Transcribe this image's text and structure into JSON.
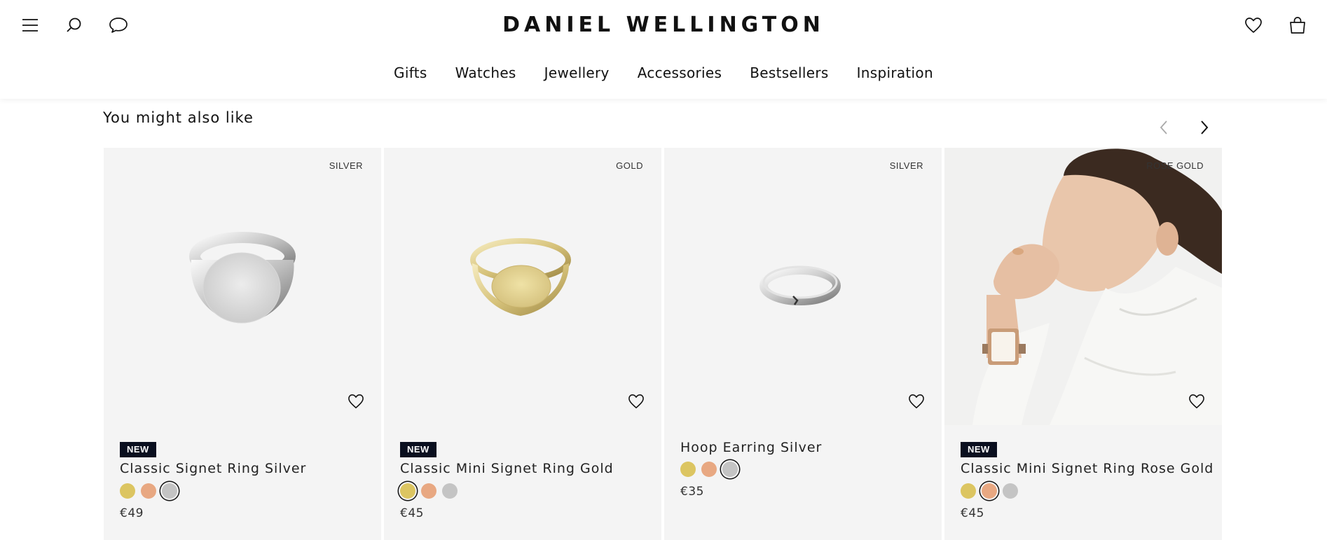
{
  "header": {
    "brand": "DANIEL WELLINGTON",
    "nav": [
      "Gifts",
      "Watches",
      "Jewellery",
      "Accessories",
      "Bestsellers",
      "Inspiration"
    ],
    "icons": [
      "menu-icon",
      "search-icon",
      "chat-icon",
      "heart-icon",
      "bag-icon"
    ]
  },
  "section": {
    "title": "You might also like"
  },
  "colors": {
    "gold": "#dcc561",
    "rose": "#e8a882",
    "silver": "#c4c4c4",
    "badge": "#0a0f1f",
    "card_bg": "#f4f4f4"
  },
  "products": [
    {
      "metal": "SILVER",
      "badge": "NEW",
      "name": "Classic Signet Ring Silver",
      "price": "€49",
      "swatches": [
        "gold",
        "rose",
        "silver"
      ],
      "selected": "silver"
    },
    {
      "metal": "GOLD",
      "badge": "NEW",
      "name": "Classic Mini Signet Ring Gold",
      "price": "€45",
      "swatches": [
        "gold",
        "rose",
        "silver"
      ],
      "selected": "gold"
    },
    {
      "metal": "SILVER",
      "badge": "",
      "name": "Hoop Earring Silver",
      "price": "€35",
      "swatches": [
        "gold",
        "rose",
        "silver"
      ],
      "selected": "silver"
    },
    {
      "metal": "ROSE GOLD",
      "badge": "NEW",
      "name": "Classic Mini Signet Ring Rose Gold",
      "price": "€45",
      "swatches": [
        "gold",
        "rose",
        "silver"
      ],
      "selected": "rose"
    }
  ]
}
